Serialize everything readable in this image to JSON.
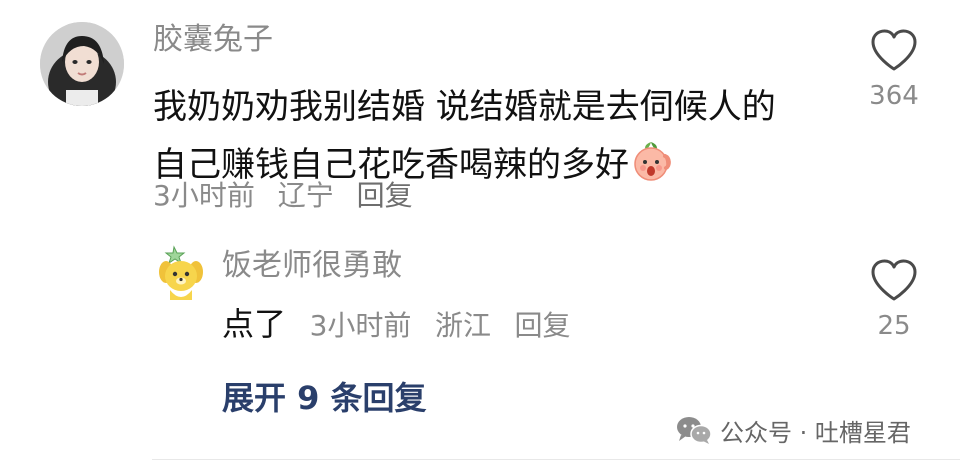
{
  "main_comment": {
    "username": "胶囊兔子",
    "text": "我奶奶劝我别结婚 说结婚就是去伺候人的 自己赚钱自己花吃香喝辣的多好",
    "emoji": "peach-face-emoji",
    "time": "3小时前",
    "location": "辽宁",
    "reply_label": "回复",
    "likes": "364"
  },
  "reply": {
    "username": "饭老师很勇敢",
    "text": "点了",
    "time": "3小时前",
    "location": "浙江",
    "reply_label": "回复",
    "likes": "25"
  },
  "expand_label": "展开 9 条回复",
  "watermark": {
    "icon": "wechat-icon",
    "text": "公众号 · 吐槽星君"
  },
  "colors": {
    "secondary_text": "#8a8a8a",
    "primary_text": "#111111",
    "expand_link": "#2a3f6b"
  }
}
